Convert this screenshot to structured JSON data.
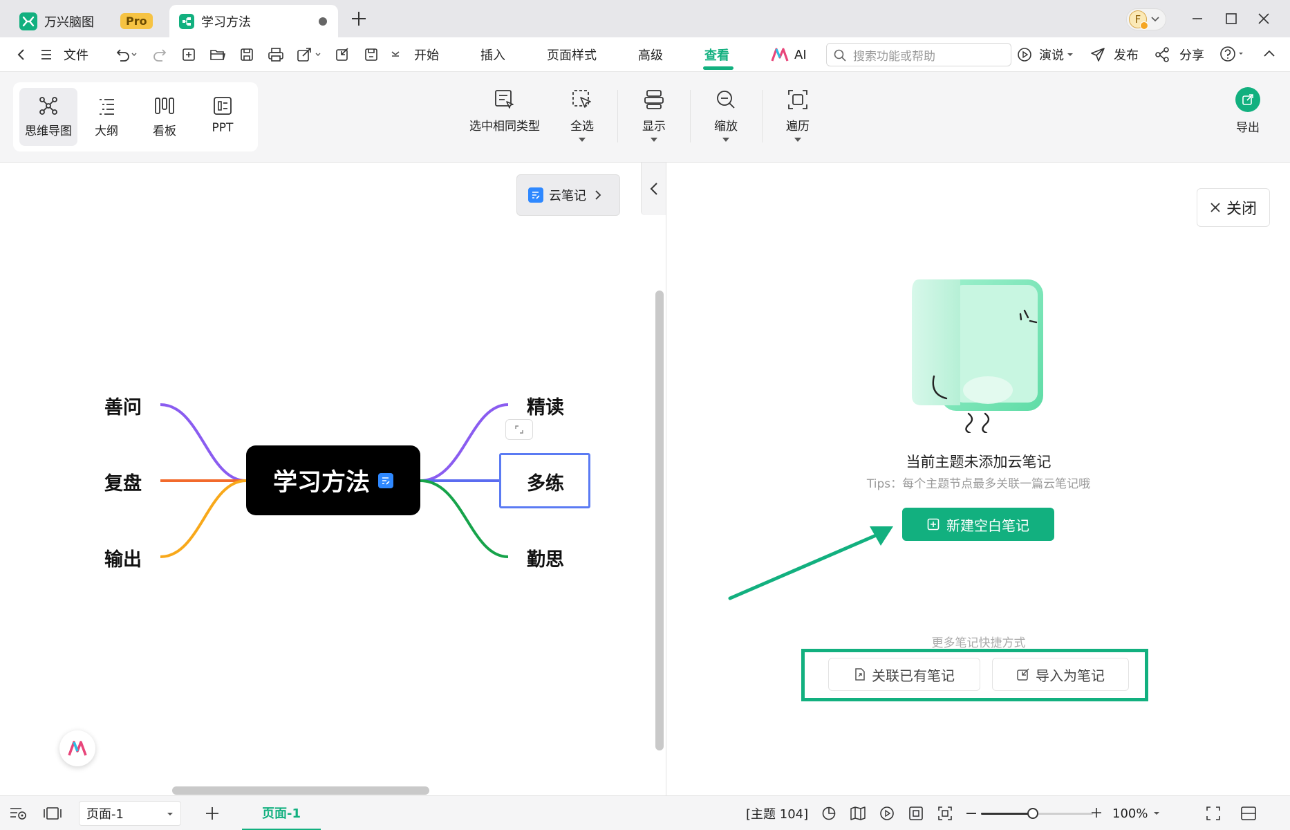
{
  "titlebar": {
    "app_name": "万兴脑图",
    "pro_badge": "Pro",
    "doc_tab": "学习方法",
    "avatar_letter": "F"
  },
  "menubar": {
    "file": "文件",
    "tabs": [
      "开始",
      "插入",
      "页面样式",
      "高级",
      "查看",
      "AI"
    ],
    "active_tab": "查看",
    "search_placeholder": "搜索功能或帮助",
    "present": "演说",
    "publish": "发布",
    "share": "分享"
  },
  "ribbon": {
    "views": [
      "思维导图",
      "大纲",
      "看板",
      "PPT"
    ],
    "active_view": "思维导图",
    "tools": [
      "选中相同类型",
      "全选",
      "显示",
      "缩放",
      "遍历"
    ],
    "export": "导出"
  },
  "canvas": {
    "cloud_note_button": "云笔记",
    "root": "学习方法",
    "left_topics": [
      "善问",
      "复盘",
      "输出"
    ],
    "right_topics": [
      "精读",
      "多练",
      "勤思"
    ],
    "selected_topic": "多练",
    "branch_colors": {
      "purple": "#8a5cf0",
      "orange": "#f26a2c",
      "yellow": "#f8a81a",
      "blue": "#5b6cf0",
      "green": "#16a34a"
    }
  },
  "panel": {
    "close": "关闭",
    "empty_title": "当前主题未添加云笔记",
    "tips": "Tips：每个主题节点最多关联一篇云笔记哦",
    "new_note": "新建空白笔记",
    "more_label": "更多笔记快捷方式",
    "link_existing": "关联已有笔记",
    "import_note": "导入为笔记",
    "accent": "#12b07f"
  },
  "statusbar": {
    "page_select": "页面-1",
    "page_tab": "页面-1",
    "topic_count": "[主题 104]",
    "zoom": "100%",
    "zoom_level": 0.46
  }
}
